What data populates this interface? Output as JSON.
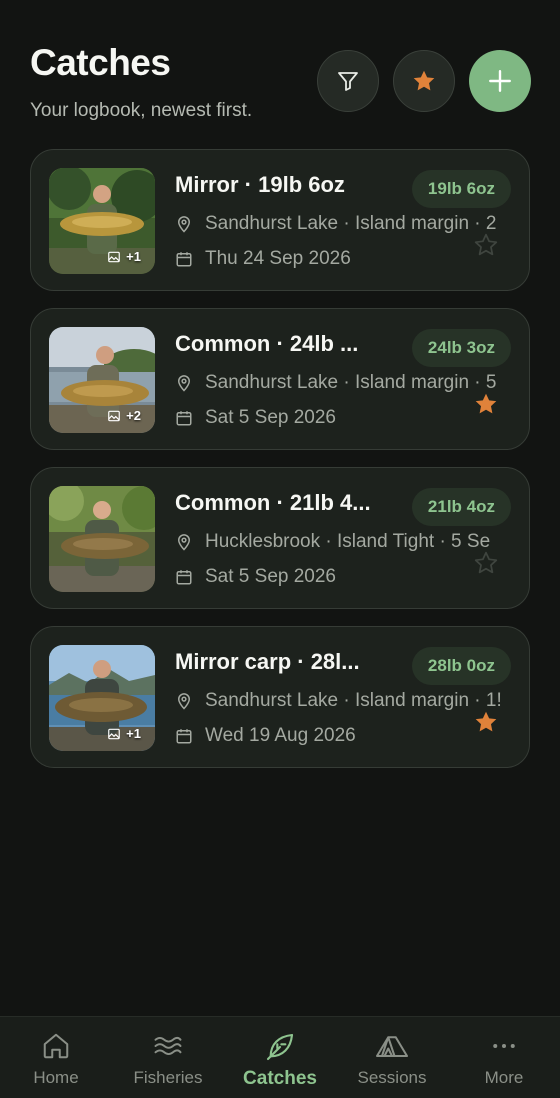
{
  "header": {
    "title": "Catches",
    "subtitle": "Your logbook, newest first."
  },
  "toolbar": {
    "filter_icon": "filter-icon",
    "favorites_icon": "star-icon",
    "add_icon": "plus-icon"
  },
  "catches": [
    {
      "title": "Mirror · 19lb 6oz",
      "weight": "19lb 6oz",
      "location": "Sandhurst Lake · Island margin · 2",
      "date": "Thu 24 Sep 2026",
      "photo_count": "+1",
      "favorite": false
    },
    {
      "title": "Common · 24lb ...",
      "weight": "24lb 3oz",
      "location": "Sandhurst Lake · Island margin · 5",
      "date": "Sat 5 Sep 2026",
      "photo_count": "+2",
      "favorite": true
    },
    {
      "title": "Common · 21lb 4...",
      "weight": "21lb 4oz",
      "location": "Hucklesbrook  · Island Tight · 5 Se",
      "date": "Sat 5 Sep 2026",
      "photo_count": "",
      "favorite": false
    },
    {
      "title": "Mirror carp · 28l...",
      "weight": "28lb 0oz",
      "location": "Sandhurst Lake · Island margin · 1!",
      "date": "Wed 19 Aug 2026",
      "photo_count": "+1",
      "favorite": true
    }
  ],
  "tabs": [
    {
      "label": "Home",
      "icon": "home-icon"
    },
    {
      "label": "Fisheries",
      "icon": "waves-icon"
    },
    {
      "label": "Catches",
      "icon": "leaf-icon",
      "active": true
    },
    {
      "label": "Sessions",
      "icon": "tent-icon"
    },
    {
      "label": "More",
      "icon": "more-icon"
    }
  ],
  "colors": {
    "background": "#121412",
    "card": "#1d221d",
    "accent": "#8ec48f",
    "add_button": "#7fb883",
    "star": "#e0823a"
  }
}
